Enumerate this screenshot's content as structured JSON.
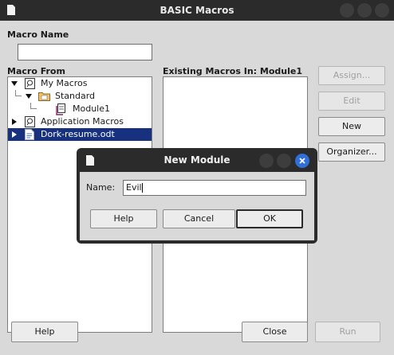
{
  "window": {
    "title": "BASIC Macros"
  },
  "macro_name": {
    "label": "Macro Name",
    "value": ""
  },
  "macro_from": {
    "label": "Macro From",
    "tree": [
      {
        "label": "My Macros",
        "expanded": true,
        "icon": "macro-library-icon"
      },
      {
        "label": "Standard",
        "expanded": true,
        "icon": "folder-icon"
      },
      {
        "label": "Module1",
        "icon": "module-icon"
      },
      {
        "label": "Application Macros",
        "expanded": false,
        "icon": "macro-library-icon"
      },
      {
        "label": "Dork-resume.odt",
        "expanded": false,
        "icon": "document-icon",
        "selected": true
      }
    ]
  },
  "existing_macros": {
    "label": "Existing Macros In: Module1"
  },
  "side_buttons": {
    "assign": "Assign...",
    "edit": "Edit",
    "new": "New",
    "organizer": "Organizer..."
  },
  "bottom_buttons": {
    "help": "Help",
    "close": "Close",
    "run": "Run"
  },
  "new_module_dialog": {
    "title": "New Module",
    "name_label": "Name:",
    "name_value": "Evil",
    "help": "Help",
    "cancel": "Cancel",
    "ok": "OK"
  },
  "colors": {
    "titlebar": "#2b2b2b",
    "dialog_bg": "#d9d9d9",
    "selection": "#17317f",
    "close_button": "#2f6fd6"
  }
}
